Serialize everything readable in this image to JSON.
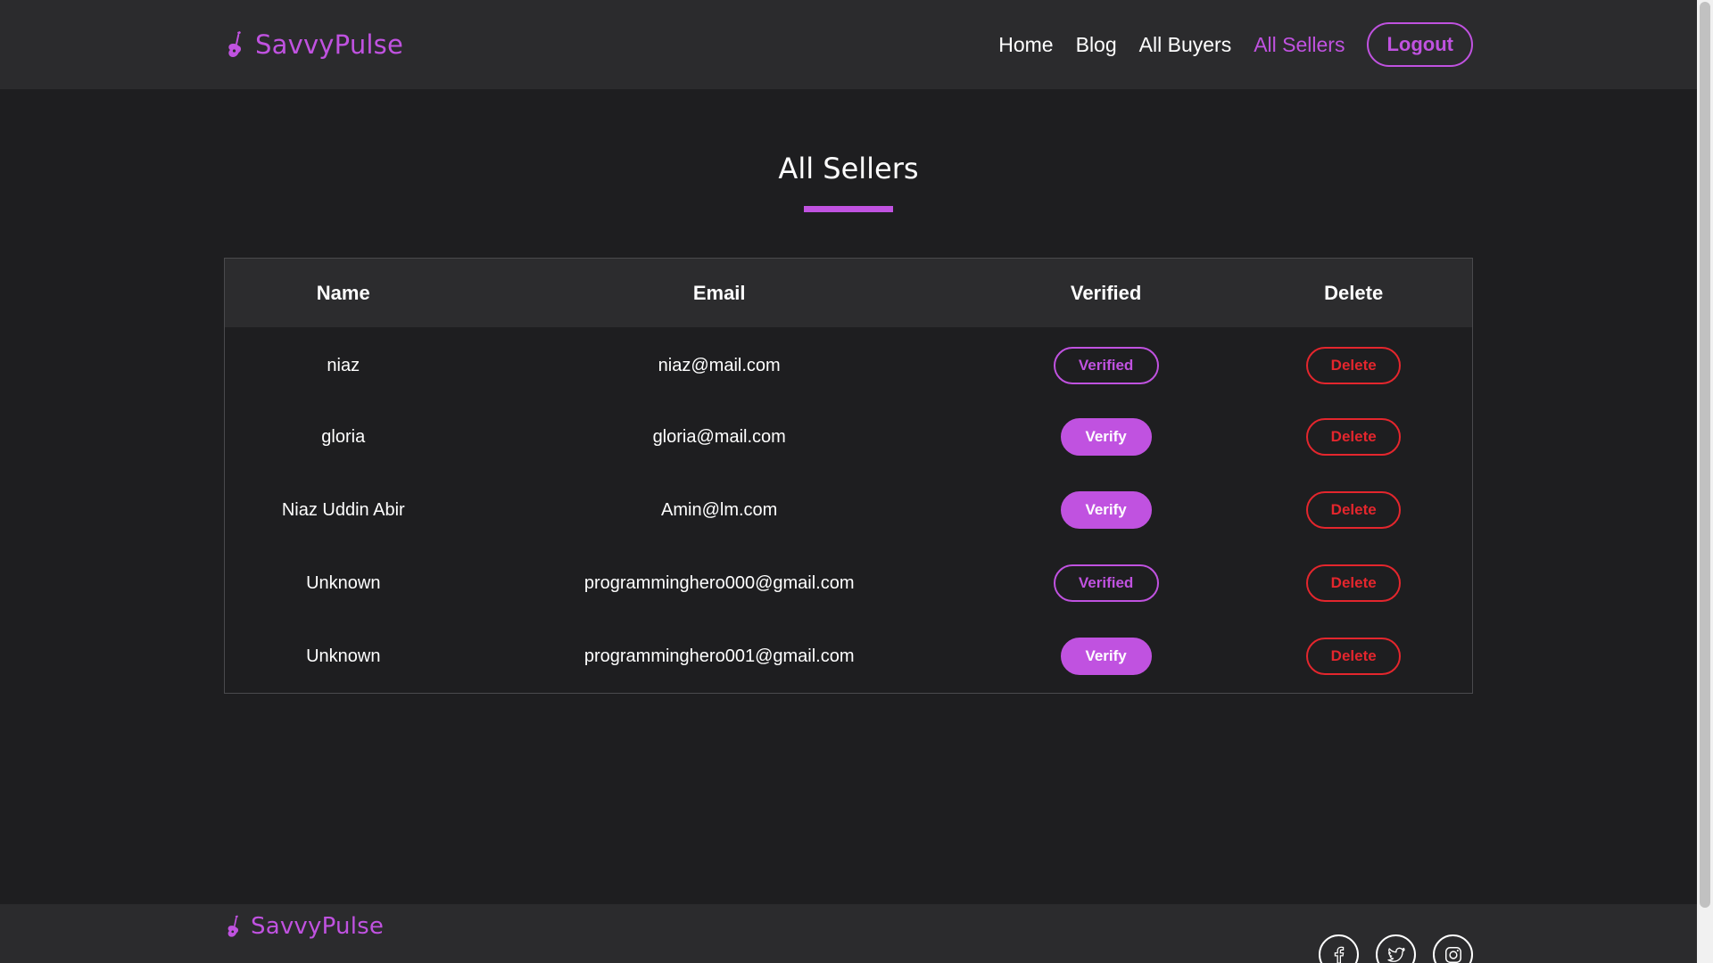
{
  "brand": {
    "name": "SavvyPulse",
    "accent_color": "#c052e0",
    "danger_color": "#e4262d"
  },
  "nav": {
    "links": [
      "Home",
      "Blog",
      "All Buyers",
      "All Sellers"
    ],
    "active": "All Sellers",
    "logout_label": "Logout"
  },
  "page": {
    "title": "All Sellers"
  },
  "table": {
    "columns": [
      "Name",
      "Email",
      "Verified",
      "Delete"
    ],
    "rows": [
      {
        "name": "niaz",
        "email": "niaz@mail.com",
        "verify_label": "Verified",
        "verified": true,
        "delete_label": "Delete"
      },
      {
        "name": "gloria",
        "email": "gloria@mail.com",
        "verify_label": "Verify",
        "verified": false,
        "delete_label": "Delete"
      },
      {
        "name": "Niaz Uddin Abir",
        "email": "Amin@lm.com",
        "verify_label": "Verify",
        "verified": false,
        "delete_label": "Delete"
      },
      {
        "name": "Unknown",
        "email": "programminghero000@gmail.com",
        "verify_label": "Verified",
        "verified": true,
        "delete_label": "Delete"
      },
      {
        "name": "Unknown",
        "email": "programminghero001@gmail.com",
        "verify_label": "Verify",
        "verified": false,
        "delete_label": "Delete"
      }
    ]
  },
  "footer": {
    "brand": "SavvyPulse",
    "social_icons": [
      "facebook-icon",
      "twitter-icon",
      "instagram-icon"
    ]
  }
}
